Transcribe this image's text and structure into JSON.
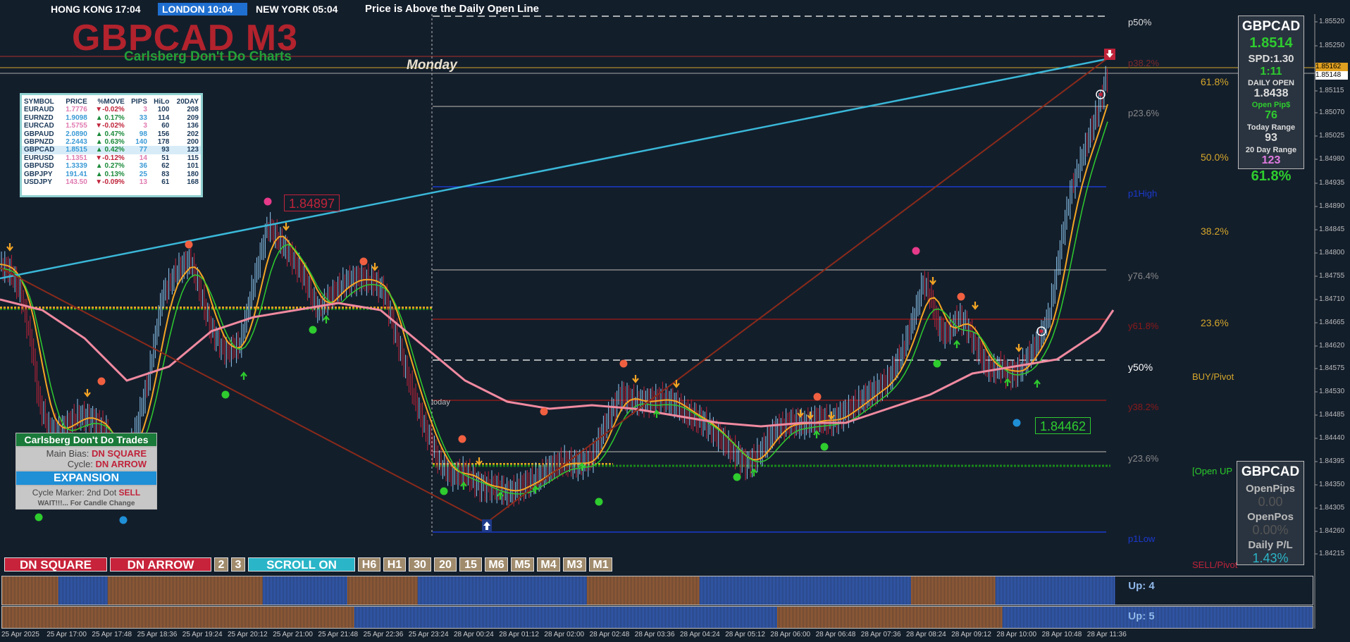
{
  "clocks": [
    {
      "label": "HONG KONG 17:04",
      "bg": "#b02434"
    },
    {
      "label": "LONDON  10:04",
      "bg": "#1f6fd0"
    },
    {
      "label": "NEW YORK  05:04",
      "bg": "#b02434"
    }
  ],
  "status_banner": {
    "label": "Price is Above the Daily Open Line",
    "bg": "#3a66d6"
  },
  "title": "GBPCAD M3",
  "subtitle": "Carlsberg Don't Do Charts",
  "day_label": "Monday",
  "today_label": "today",
  "symbol_table": {
    "headers": [
      "SYMBOL",
      "PRICE",
      "%MOVE",
      "PIPS",
      "HiLo",
      "20DAY"
    ],
    "rows": [
      {
        "symbol": "EURAUD",
        "price": "1.7776",
        "move": "▼-0.02%",
        "pips": "3",
        "hilo": "100",
        "twenty": "208",
        "dir": "down"
      },
      {
        "symbol": "EURNZD",
        "price": "1.9098",
        "move": "▲ 0.17%",
        "pips": "33",
        "hilo": "114",
        "twenty": "209",
        "dir": "up"
      },
      {
        "symbol": "EURCAD",
        "price": "1.5755",
        "move": "▼-0.02%",
        "pips": "3",
        "hilo": "60",
        "twenty": "136",
        "dir": "down"
      },
      {
        "symbol": "GBPAUD",
        "price": "2.0890",
        "move": "▲ 0.47%",
        "pips": "98",
        "hilo": "156",
        "twenty": "202",
        "dir": "up"
      },
      {
        "symbol": "GBPNZD",
        "price": "2.2443",
        "move": "▲ 0.63%",
        "pips": "140",
        "hilo": "178",
        "twenty": "200",
        "dir": "up"
      },
      {
        "symbol": "GBPCAD",
        "price": "1.8515",
        "move": "▲ 0.42%",
        "pips": "77",
        "hilo": "93",
        "twenty": "123",
        "dir": "up",
        "hl": true
      },
      {
        "symbol": "EURUSD",
        "price": "1.1351",
        "move": "▼-0.12%",
        "pips": "14",
        "hilo": "51",
        "twenty": "115",
        "dir": "down"
      },
      {
        "symbol": "GBPUSD",
        "price": "1.3339",
        "move": "▲ 0.27%",
        "pips": "36",
        "hilo": "62",
        "twenty": "101",
        "dir": "up"
      },
      {
        "symbol": "GBPJPY",
        "price": "191.41",
        "move": "▲ 0.13%",
        "pips": "25",
        "hilo": "83",
        "twenty": "180",
        "dir": "up"
      },
      {
        "symbol": "USDJPY",
        "price": "143.50",
        "move": "▼-0.09%",
        "pips": "13",
        "hilo": "61",
        "twenty": "168",
        "dir": "down"
      }
    ]
  },
  "trades_box": {
    "header": "Carlsberg Don't Do Trades",
    "bias_label": "Main Bias:",
    "bias_value": "DN SQUARE",
    "cycle_label": "Cycle:",
    "cycle_value": "DN ARROW",
    "state": "EXPANSION",
    "marker_label": "Cycle Marker: 2nd Dot",
    "marker_value": "SELL",
    "wait": "WAIT!!!... For Candle Change"
  },
  "buttons": [
    {
      "label": "DN SQUARE",
      "kind": "r",
      "w": 146
    },
    {
      "label": "DN ARROW",
      "kind": "r",
      "w": 144
    },
    {
      "label": "2",
      "kind": "t",
      "w": 20
    },
    {
      "label": "3",
      "kind": "t",
      "w": 20
    },
    {
      "label": "SCROLL ON",
      "kind": "c",
      "w": 152
    },
    {
      "label": "H6",
      "kind": "t",
      "w": 32
    },
    {
      "label": "H1",
      "kind": "t",
      "w": 32
    },
    {
      "label": "30",
      "kind": "t",
      "w": 32
    },
    {
      "label": "20",
      "kind": "t",
      "w": 32
    },
    {
      "label": "15",
      "kind": "t",
      "w": 32
    },
    {
      "label": "M6",
      "kind": "t",
      "w": 33
    },
    {
      "label": "M5",
      "kind": "t",
      "w": 33
    },
    {
      "label": "M4",
      "kind": "t",
      "w": 33
    },
    {
      "label": "M3",
      "kind": "t",
      "w": 33
    },
    {
      "label": "M1",
      "kind": "t",
      "w": 33
    }
  ],
  "info_panel": {
    "symbol": "GBPCAD",
    "price": "1.8514",
    "spread": "SPD:1.30",
    "timer": "1:11",
    "daily_open_label": "DAILY OPEN",
    "daily_open": "1.8438",
    "open_pips_label": "Open Pip$",
    "open_pips": "76",
    "today_range_label": "Today Range",
    "today_range": "93",
    "twenty_day_label": "20 Day Range",
    "twenty_day": "123",
    "percent": "61.8%"
  },
  "pl_panel": {
    "symbol": "GBPCAD",
    "open_pips_label": "OpenPips",
    "open_pips": "0.00",
    "open_pos_label": "OpenPos",
    "open_pos": "0.00%",
    "daily_pl_label": "Daily P/L",
    "daily_pl": "1.43%"
  },
  "levels": [
    {
      "label": "p50%",
      "color": "#dddddd"
    },
    {
      "label": "p38.2%",
      "color": "#7a2a2a"
    },
    {
      "label": "p23.6%",
      "color": "#888888"
    },
    {
      "label": "p1High",
      "color": "#1a3acc"
    },
    {
      "label": "y76.4%",
      "color": "#888888"
    },
    {
      "label": "y61.8%",
      "color": "#8a1a1a"
    },
    {
      "label": "y50%",
      "color": "#ffffff"
    },
    {
      "label": "y38.2%",
      "color": "#8a1a1a"
    },
    {
      "label": "y23.6%",
      "color": "#888888"
    },
    {
      "label": "[Open UP",
      "color": "#2acc2a"
    },
    {
      "label": "p1Low",
      "color": "#1a3acc"
    },
    {
      "label": "BUY/Pivot",
      "color": "#d4a62a"
    },
    {
      "label": "SELL/Pivot",
      "color": "#c0233a"
    }
  ],
  "fib_labels": [
    "61.8%",
    "50.0%",
    "38.2%",
    "23.6%"
  ],
  "price_scale": [
    "1.85520",
    "1.85250",
    "1.85115",
    "1.85070",
    "1.85025",
    "1.84980",
    "1.84935",
    "1.84890",
    "1.84845",
    "1.84800",
    "1.84755",
    "1.84710",
    "1.84665",
    "1.84620",
    "1.84575",
    "1.84530",
    "1.84485",
    "1.84440",
    "1.84395",
    "1.84350",
    "1.84305",
    "1.84260",
    "1.84215"
  ],
  "price_markers": {
    "ask": "1.85162",
    "bid": "1.85148"
  },
  "bubbles": {
    "high": "1.84897",
    "low": "1.84462"
  },
  "time_axis": [
    "25 Apr 2025",
    "25 Apr 17:00",
    "25 Apr 17:48",
    "25 Apr 18:36",
    "25 Apr 19:24",
    "25 Apr 20:12",
    "25 Apr 21:00",
    "25 Apr 21:48",
    "25 Apr 22:36",
    "25 Apr 23:24",
    "28 Apr 00:24",
    "28 Apr 01:12",
    "28 Apr 02:00",
    "28 Apr 02:48",
    "28 Apr 03:36",
    "28 Apr 04:24",
    "28 Apr 05:12",
    "28 Apr 06:00",
    "28 Apr 06:48",
    "28 Apr 07:36",
    "28 Apr 08:24",
    "28 Apr 09:12",
    "28 Apr 10:00",
    "28 Apr 10:48",
    "28 Apr 11:36"
  ],
  "indicators": {
    "up4": "Up: 4",
    "up5": "Up: 5"
  },
  "colors": {
    "bg": "#131e2b",
    "bull": "#8ec8f0",
    "bear": "#c0233a",
    "ma_fast": "#f5a623",
    "ma_mid": "#2ecc2e",
    "ma_slow": "#f08aa0",
    "trend": "#3ab8d8"
  }
}
